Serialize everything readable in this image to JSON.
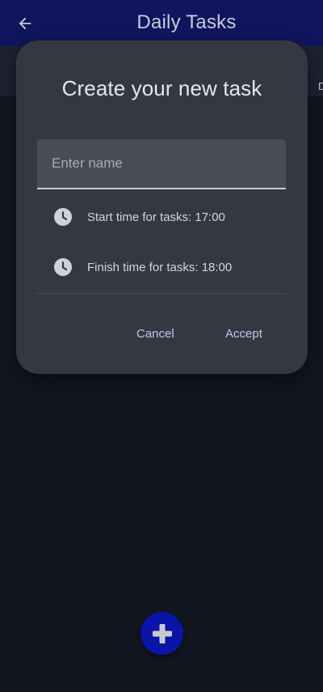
{
  "appbar": {
    "title": "Daily Tasks",
    "back_icon": "arrow-left-icon"
  },
  "tabs": {
    "peek_label": "D"
  },
  "dialog": {
    "title": "Create your new task",
    "name_field": {
      "value": "",
      "placeholder": "Enter name"
    },
    "start_time": {
      "icon": "clock-icon",
      "label": "Start time for tasks: 17:00"
    },
    "finish_time": {
      "icon": "clock-icon",
      "label": "Finish time for tasks: 18:00"
    },
    "cancel_label": "Cancel",
    "accept_label": "Accept"
  },
  "fab": {
    "icon": "plus-icon"
  },
  "colors": {
    "appbar": "#10155e",
    "background": "#121620",
    "dialog": "#353840",
    "accent_text": "#c3c5ee",
    "fab": "#0a14a8"
  }
}
